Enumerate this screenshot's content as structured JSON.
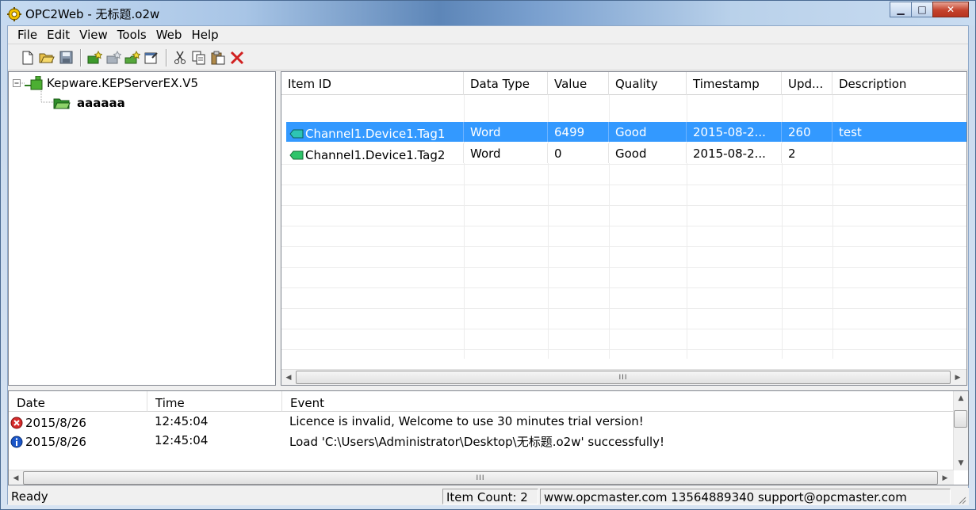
{
  "window": {
    "title": "OPC2Web - 无标题.o2w"
  },
  "menu": [
    "File",
    "Edit",
    "View",
    "Tools",
    "Web",
    "Help"
  ],
  "toolbar": [
    "new-file-icon",
    "open-folder-icon",
    "save-icon",
    "add-server-icon",
    "add-group-icon",
    "add-item-icon",
    "properties-icon",
    "cut-icon",
    "copy-icon",
    "paste-icon",
    "delete-icon"
  ],
  "tree": {
    "server": "Kepware.KEPServerEX.V5",
    "group": "aaaaaa"
  },
  "grid": {
    "columns": [
      "Item ID",
      "Data Type",
      "Value",
      "Quality",
      "Timestamp",
      "Upd...",
      "Description"
    ],
    "rows": [
      {
        "item_id": "Channel1.Device1.Tag1",
        "data_type": "Word",
        "value": "6499",
        "quality": "Good",
        "timestamp": "2015-08-2...",
        "update": "260",
        "description": "test",
        "selected": true
      },
      {
        "item_id": "Channel1.Device1.Tag2",
        "data_type": "Word",
        "value": "0",
        "quality": "Good",
        "timestamp": "2015-08-2...",
        "update": "2",
        "description": "",
        "selected": false
      }
    ],
    "scroll_thumb": "III"
  },
  "log": {
    "columns": [
      "Date",
      "Time",
      "Event"
    ],
    "rows": [
      {
        "icon": "error-icon",
        "date": "2015/8/26",
        "time": "12:45:04",
        "event": "Licence is invalid, Welcome to use 30 minutes trial version!"
      },
      {
        "icon": "info-icon",
        "date": "2015/8/26",
        "time": "12:45:04",
        "event": "Load 'C:\\Users\\Administrator\\Desktop\\无标题.o2w' successfully!"
      }
    ],
    "scroll_thumb": "III"
  },
  "status": {
    "ready": "Ready",
    "item_count": "Item Count: 2",
    "contact": "www.opcmaster.com 13564889340 support@opcmaster.com"
  },
  "colors": {
    "selection": "#3399ff",
    "close_button": "#c4432d"
  }
}
